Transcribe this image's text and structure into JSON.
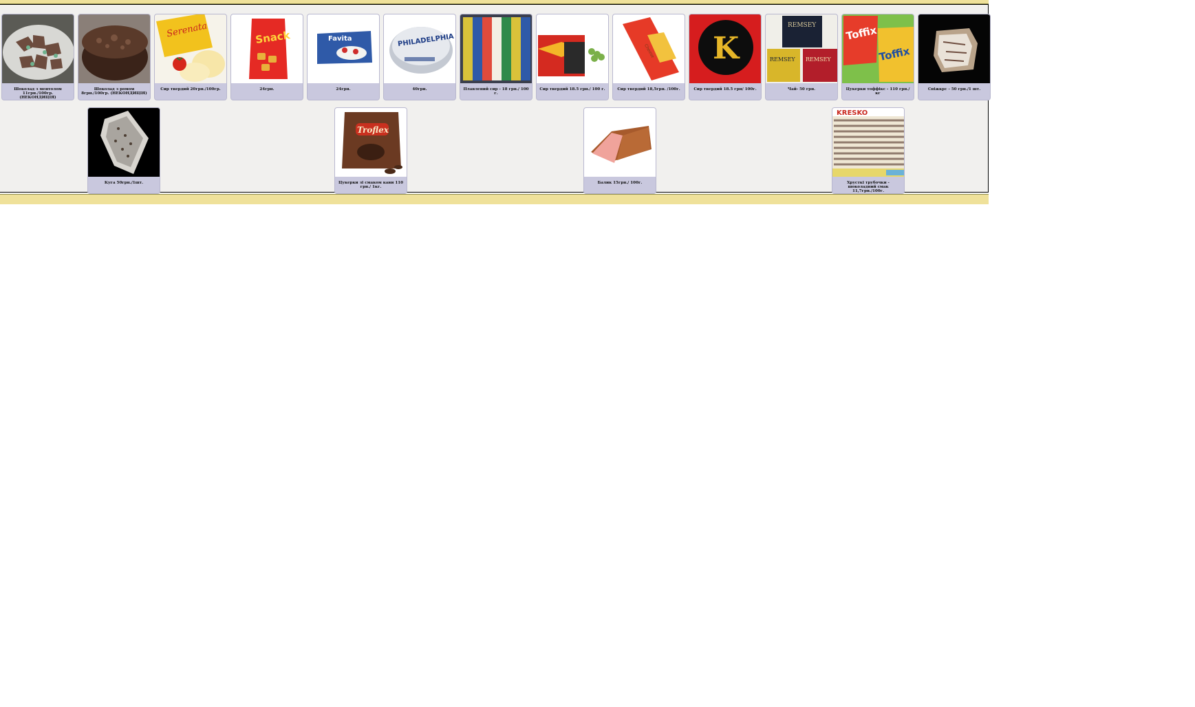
{
  "products_row1": [
    {
      "caption": "Шоколад з ментолом 11грн./100гр. (НЕКОНДИЦІЯ)",
      "icon": "mint-chocolate-image"
    },
    {
      "caption": "Шоколад з ромом 8грн./100гр. (НЕКОНДИЦІЯ)",
      "icon": "rum-chocolate-image"
    },
    {
      "caption": "Сир твердий 20грн./100гр.",
      "icon": "cheese-serenada-image"
    },
    {
      "caption": "24грн.",
      "icon": "snacks-bag-image"
    },
    {
      "caption": "24грн.",
      "icon": "favita-box-image"
    },
    {
      "caption": "40грн.",
      "icon": "philadelphia-tub-image"
    },
    {
      "caption": "Плавлений сир - 18 грн./ 100 г.",
      "icon": "processed-cheese-image"
    },
    {
      "caption": "Сир твердий 18.5 грн./ 100 г.",
      "icon": "cheese-block-image"
    },
    {
      "caption": "Сир твердий 18,5грн. /100г.",
      "icon": "cheese-bar-image"
    },
    {
      "caption": "Сир твердий 18.5 грн/ 100г.",
      "icon": "cheese-kastelan-image"
    },
    {
      "caption": "Чай- 50 грн.",
      "icon": "remsey-tea-image"
    },
    {
      "caption": "Цукерки тоффікс - 110 грн./ кг",
      "icon": "toffix-candy-image"
    },
    {
      "caption": "Сніжкрс - 50 грн./1 шт.",
      "icon": "dark-item-image"
    }
  ],
  "products_row2": [
    {
      "caption": "Куга 50грн./1шт.",
      "icon": "dark-pork-image"
    },
    {
      "caption": "Цукерки зі смаком кави 110 грн./ 1кг.",
      "icon": "troflex-coffee-candy-image"
    },
    {
      "caption": "Балик 15грн./ 100г.",
      "icon": "balyk-meat-image"
    },
    {
      "caption": "Хрусткі трубочки - шоколадний смак 11,7грн./100г.",
      "icon": "kresko-wafer-rolls-image"
    }
  ]
}
